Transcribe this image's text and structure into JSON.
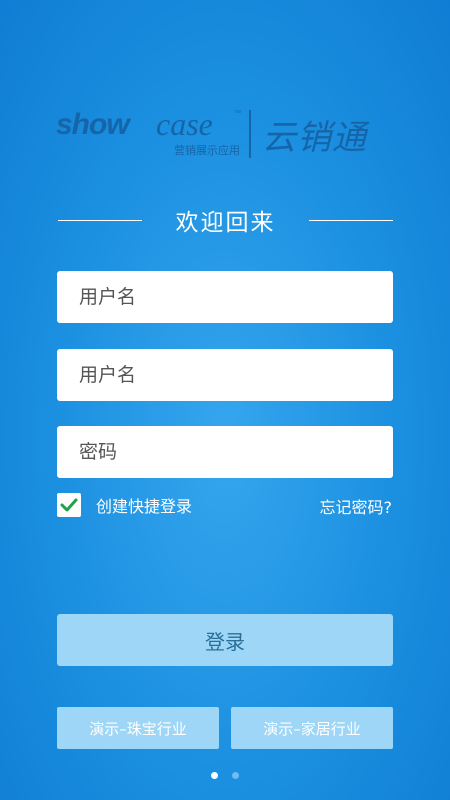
{
  "logo": {
    "show_text": "show",
    "case_text": "case",
    "tm": "™",
    "tagline": "营销展示应用",
    "product_name": "云销通"
  },
  "welcome": {
    "title": "欢迎回来"
  },
  "form": {
    "username_placeholder": "用户名",
    "username2_placeholder": "用户名",
    "password_placeholder": "密码",
    "remember_label": "创建快捷登录",
    "remember_checked": true,
    "forgot_label": "忘记密码?",
    "login_label": "登录"
  },
  "demos": [
    {
      "label": "演示–珠宝行业"
    },
    {
      "label": "演示–家居行业"
    }
  ],
  "pager": {
    "active_index": 0,
    "count": 2
  },
  "colors": {
    "background": "#1b8fe0",
    "logo": "#1565a8",
    "button": "#9ed6f7",
    "check": "#1fa34a"
  }
}
